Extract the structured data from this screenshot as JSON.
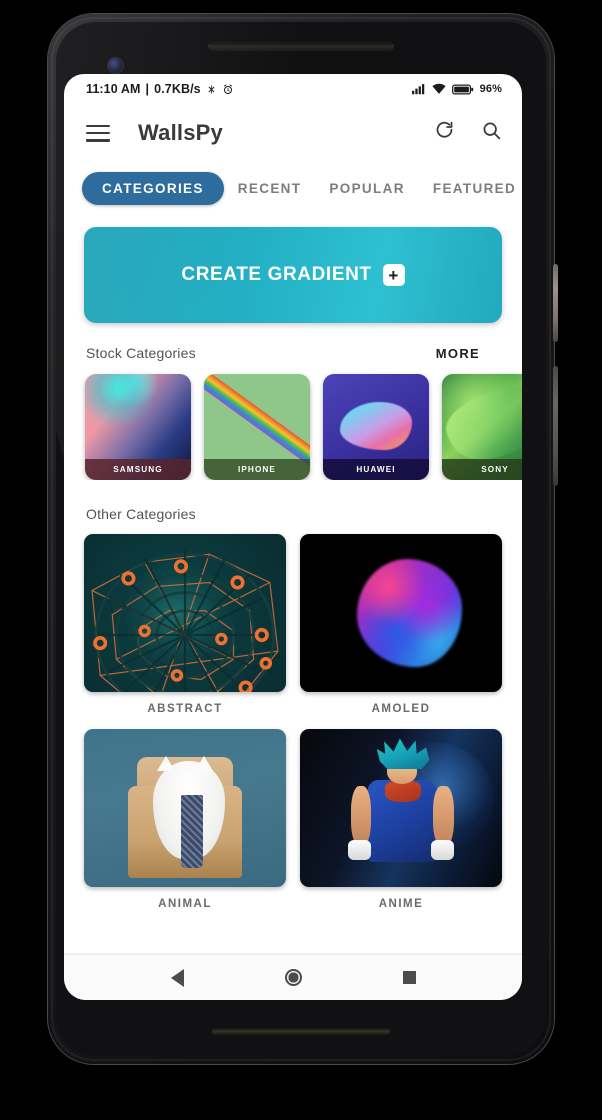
{
  "status_bar": {
    "time": "11:10 AM",
    "separator": "|",
    "network_speed": "0.7KB/s",
    "icons": [
      "bluetooth-off-icon",
      "alarm-icon"
    ],
    "right_icons": [
      "signal-icon",
      "wifi-icon",
      "battery-icon"
    ],
    "battery_percent": "96%"
  },
  "toolbar": {
    "menu_icon": "hamburger-menu-icon",
    "title": "WallsPy",
    "refresh_icon": "refresh-icon",
    "search_icon": "search-icon"
  },
  "tabs": {
    "items": [
      {
        "label": "CATEGORIES",
        "active": true
      },
      {
        "label": "RECENT",
        "active": false
      },
      {
        "label": "POPULAR",
        "active": false
      },
      {
        "label": "FEATURED",
        "active": false
      }
    ],
    "active_color": "#2d6c9c"
  },
  "create_gradient": {
    "label": "CREATE GRADIENT",
    "plus_glyph": "+",
    "color_start": "#21a3b8",
    "color_end": "#2ec0d2"
  },
  "stock_section": {
    "title": "Stock Categories",
    "more_label": "MORE",
    "cards": [
      {
        "label": "SAMSUNG"
      },
      {
        "label": "IPHONE"
      },
      {
        "label": "HUAWEI"
      },
      {
        "label": "SONY"
      }
    ]
  },
  "other_section": {
    "title": "Other Categories",
    "cells": [
      {
        "label": "ABSTRACT"
      },
      {
        "label": "AMOLED"
      },
      {
        "label": "ANIMAL"
      },
      {
        "label": "ANIME"
      }
    ]
  },
  "navigation_bar": {
    "back": "back-icon",
    "home": "home-icon",
    "recents": "recents-icon"
  }
}
